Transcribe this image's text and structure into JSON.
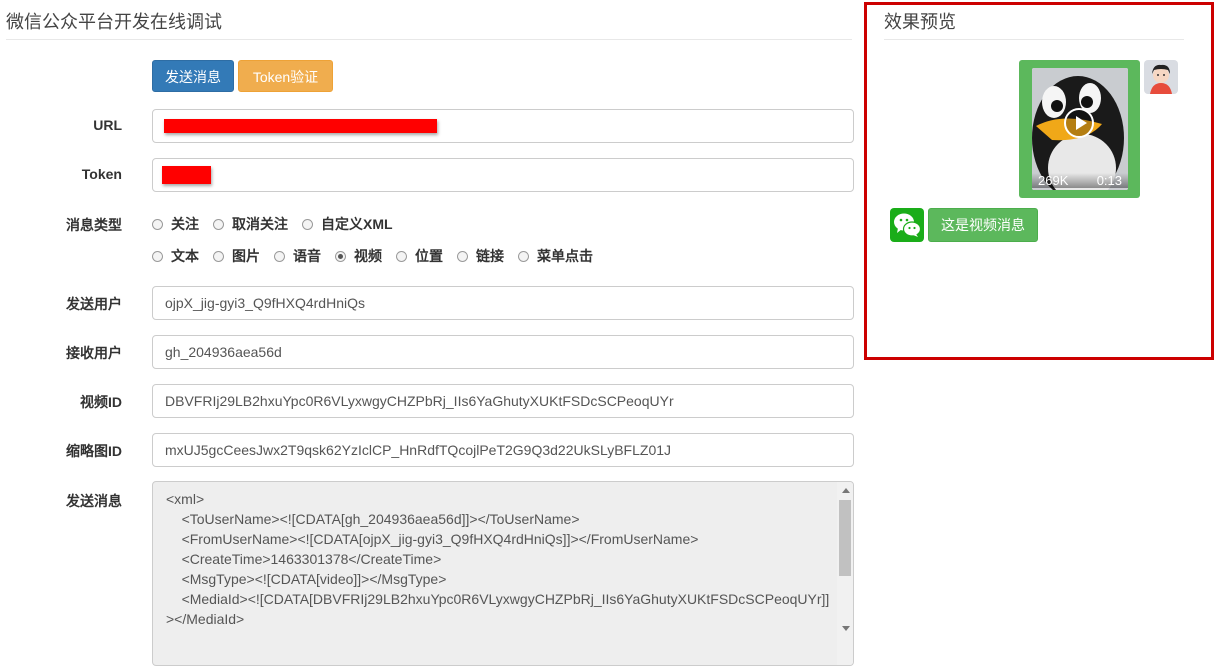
{
  "left": {
    "title": "微信公众平台开发在线调试",
    "buttons": {
      "send": "发送消息",
      "token": "Token验证"
    },
    "fields": {
      "url": {
        "label": "URL",
        "value": ""
      },
      "token": {
        "label": "Token",
        "value": ""
      },
      "msg_type": {
        "label": "消息类型",
        "row1": [
          "关注",
          "取消关注",
          "自定义XML"
        ],
        "row2": [
          "文本",
          "图片",
          "语音",
          "视频",
          "位置",
          "链接",
          "菜单点击"
        ],
        "selected": "视频"
      },
      "from_user": {
        "label": "发送用户",
        "value": "ojpX_jig-gyi3_Q9fHXQ4rdHniQs"
      },
      "to_user": {
        "label": "接收用户",
        "value": "gh_204936aea56d"
      },
      "video_id": {
        "label": "视频ID",
        "value": "DBVFRIj29LB2hxuYpc0R6VLyxwgyCHZPbRj_IIs6YaGhutyXUKtFSDcSCPeoqUYr"
      },
      "thumb_id": {
        "label": "缩略图ID",
        "value": "mxUJ5gcCeesJwx2T9qsk62YzIclCP_HnRdfTQcojlPeT2G9Q3d22UkSLyBFLZ01J"
      },
      "message": {
        "label": "发送消息",
        "xml": "<xml>\n    <ToUserName><![CDATA[gh_204936aea56d]]></ToUserName>\n    <FromUserName><![CDATA[ojpX_jig-gyi3_Q9fHXQ4rdHniQs]]></FromUserName>\n    <CreateTime>1463301378</CreateTime>\n    <MsgType><![CDATA[video]]></MsgType>\n    <MediaId><![CDATA[DBVFRIj29LB2hxuYpc0R6VLyxwgyCHZPbRj_IIs6YaGhutyXUKtFSDcSCPeoqUYr]]></MediaId>"
      }
    }
  },
  "preview": {
    "title": "效果预览",
    "video": {
      "size": "269K",
      "duration": "0:13"
    },
    "reply_text": "这是视频消息"
  },
  "colors": {
    "primary": "#337ab7",
    "warning": "#f0ad4e",
    "success": "#5cb85c",
    "highlight_border": "#cc0000",
    "redaction": "#ff0000"
  }
}
